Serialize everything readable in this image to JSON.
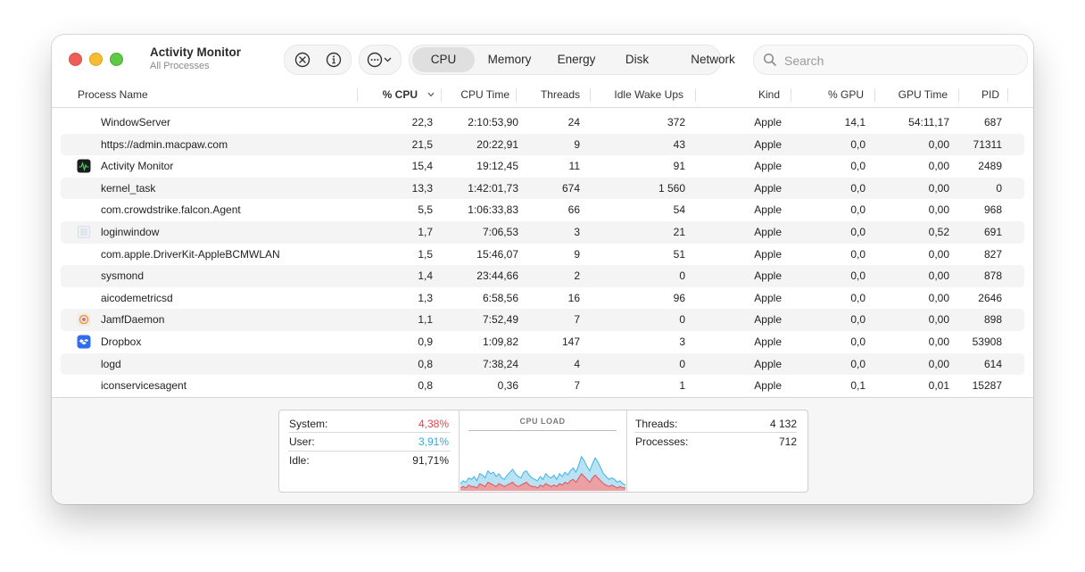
{
  "window": {
    "title": "Activity Monitor",
    "subtitle": "All Processes"
  },
  "toolbar": {
    "tabs": [
      {
        "label": "CPU",
        "active": true
      },
      {
        "label": "Memory",
        "active": false
      },
      {
        "label": "Energy",
        "active": false
      },
      {
        "label": "Disk",
        "active": false
      },
      {
        "label": "Network",
        "active": false
      }
    ],
    "search": {
      "placeholder": "Search",
      "value": ""
    }
  },
  "table": {
    "columns": [
      "Process Name",
      "% CPU",
      "CPU Time",
      "Threads",
      "Idle Wake Ups",
      "Kind",
      "% GPU",
      "GPU Time",
      "PID"
    ],
    "sorted_column": "% CPU",
    "rows": [
      {
        "name": "WindowServer",
        "icon": "",
        "cpu": "22,3",
        "cpu_time": "2:10:53,90",
        "threads": "24",
        "idle_wake_ups": "372",
        "kind": "Apple",
        "gpu": "14,1",
        "gpu_time": "54:11,17",
        "pid": "687"
      },
      {
        "name": "https://admin.macpaw.com",
        "icon": "",
        "cpu": "21,5",
        "cpu_time": "20:22,91",
        "threads": "9",
        "idle_wake_ups": "43",
        "kind": "Apple",
        "gpu": "0,0",
        "gpu_time": "0,00",
        "pid": "71311"
      },
      {
        "name": "Activity Monitor",
        "icon": "activity-monitor-icon",
        "cpu": "15,4",
        "cpu_time": "19:12,45",
        "threads": "11",
        "idle_wake_ups": "91",
        "kind": "Apple",
        "gpu": "0,0",
        "gpu_time": "0,00",
        "pid": "2489"
      },
      {
        "name": "kernel_task",
        "icon": "",
        "cpu": "13,3",
        "cpu_time": "1:42:01,73",
        "threads": "674",
        "idle_wake_ups": "1 560",
        "kind": "Apple",
        "gpu": "0,0",
        "gpu_time": "0,00",
        "pid": "0"
      },
      {
        "name": "com.crowdstrike.falcon.Agent",
        "icon": "",
        "cpu": "5,5",
        "cpu_time": "1:06:33,83",
        "threads": "66",
        "idle_wake_ups": "54",
        "kind": "Apple",
        "gpu": "0,0",
        "gpu_time": "0,00",
        "pid": "968"
      },
      {
        "name": "loginwindow",
        "icon": "loginwindow-icon",
        "cpu": "1,7",
        "cpu_time": "7:06,53",
        "threads": "3",
        "idle_wake_ups": "21",
        "kind": "Apple",
        "gpu": "0,0",
        "gpu_time": "0,52",
        "pid": "691"
      },
      {
        "name": "com.apple.DriverKit-AppleBCMWLAN",
        "icon": "",
        "cpu": "1,5",
        "cpu_time": "15:46,07",
        "threads": "9",
        "idle_wake_ups": "51",
        "kind": "Apple",
        "gpu": "0,0",
        "gpu_time": "0,00",
        "pid": "827"
      },
      {
        "name": "sysmond",
        "icon": "",
        "cpu": "1,4",
        "cpu_time": "23:44,66",
        "threads": "2",
        "idle_wake_ups": "0",
        "kind": "Apple",
        "gpu": "0,0",
        "gpu_time": "0,00",
        "pid": "878"
      },
      {
        "name": "aicodemetricsd",
        "icon": "",
        "cpu": "1,3",
        "cpu_time": "6:58,56",
        "threads": "16",
        "idle_wake_ups": "96",
        "kind": "Apple",
        "gpu": "0,0",
        "gpu_time": "0,00",
        "pid": "2646"
      },
      {
        "name": "JamfDaemon",
        "icon": "jamf-icon",
        "cpu": "1,1",
        "cpu_time": "7:52,49",
        "threads": "7",
        "idle_wake_ups": "0",
        "kind": "Apple",
        "gpu": "0,0",
        "gpu_time": "0,00",
        "pid": "898"
      },
      {
        "name": "Dropbox",
        "icon": "dropbox-icon",
        "cpu": "0,9",
        "cpu_time": "1:09,82",
        "threads": "147",
        "idle_wake_ups": "3",
        "kind": "Apple",
        "gpu": "0,0",
        "gpu_time": "0,00",
        "pid": "53908"
      },
      {
        "name": "logd",
        "icon": "",
        "cpu": "0,8",
        "cpu_time": "7:38,24",
        "threads": "4",
        "idle_wake_ups": "0",
        "kind": "Apple",
        "gpu": "0,0",
        "gpu_time": "0,00",
        "pid": "614"
      },
      {
        "name": "iconservicesagent",
        "icon": "",
        "cpu": "0,8",
        "cpu_time": "0,36",
        "threads": "7",
        "idle_wake_ups": "1",
        "kind": "Apple",
        "gpu": "0,1",
        "gpu_time": "0,01",
        "pid": "15287"
      }
    ]
  },
  "summary": {
    "system_label": "System:",
    "system_value": "4,38%",
    "user_label": "User:",
    "user_value": "3,91%",
    "idle_label": "Idle:",
    "idle_value": "91,71%",
    "cpu_load_title": "CPU LOAD",
    "threads_label": "Threads:",
    "threads_value": "4 132",
    "processes_label": "Processes:",
    "processes_value": "712"
  },
  "cpu_load_graph": {
    "system_color": "#e0555a",
    "user_color": "#3fb3e6",
    "system": [
      2,
      3,
      2,
      4,
      3,
      3,
      2,
      5,
      4,
      3,
      6,
      5,
      4,
      3,
      5,
      4,
      3,
      4,
      5,
      6,
      4,
      3,
      4,
      5,
      6,
      4,
      3,
      3,
      2,
      4,
      3,
      5,
      4,
      3,
      4,
      3,
      5,
      4,
      6,
      5,
      7,
      8,
      6,
      9,
      12,
      10,
      8,
      6,
      9,
      11,
      9,
      7,
      5,
      4,
      3,
      4,
      3,
      2,
      3,
      2,
      2
    ],
    "user": [
      5,
      7,
      6,
      9,
      8,
      10,
      7,
      12,
      11,
      9,
      14,
      12,
      13,
      10,
      12,
      9,
      8,
      11,
      13,
      15,
      12,
      10,
      9,
      13,
      14,
      11,
      9,
      8,
      7,
      10,
      8,
      12,
      10,
      9,
      11,
      8,
      12,
      10,
      13,
      11,
      14,
      16,
      13,
      18,
      24,
      21,
      17,
      14,
      19,
      23,
      20,
      16,
      12,
      10,
      8,
      9,
      8,
      6,
      7,
      5,
      4
    ],
    "max": 40
  },
  "colors": {
    "accent_red": "#e0555a",
    "accent_blue": "#3fb3e6",
    "tab_active_bg": "#dfdfdf"
  }
}
